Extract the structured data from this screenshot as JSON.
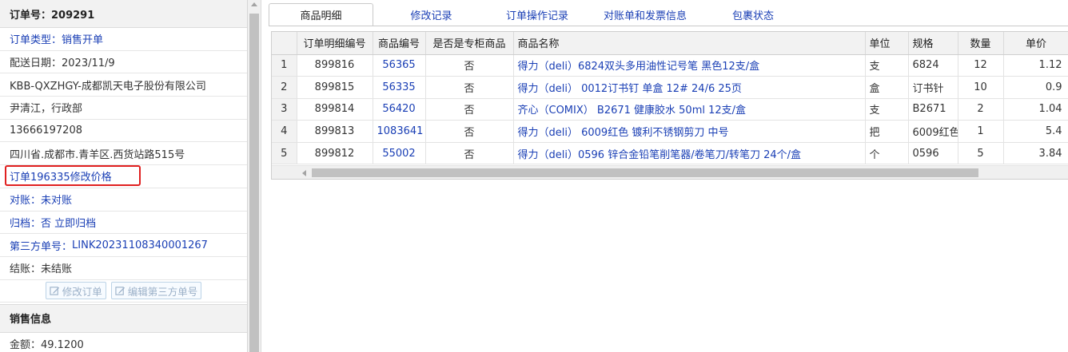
{
  "order": {
    "header": "订单号：209291",
    "type_label": "订单类型：",
    "type_value": "销售开单",
    "delivery_date": "配送日期：2023/11/9",
    "company": "KBB-QXZHGY-成都凯天电子股份有限公司",
    "contact": "尹清江，行政部",
    "phone": "13666197208",
    "address": "四川省.成都市.青羊区.西货站路515号",
    "price_change_note": "订单196335修改价格",
    "reconcile_label": "对账：",
    "reconcile_value": "未对账",
    "archive_label": "归档：",
    "archive_value": "否 立即归档",
    "third_party_label": "第三方单号：",
    "third_party_value": "LINK20231108340001267",
    "settle_label": "结账：",
    "settle_value": "未结账",
    "edit_order_label": "修改订单",
    "edit_third_party_label": "编辑第三方单号"
  },
  "sales": {
    "header": "销售信息",
    "amount": "金额：49.1200"
  },
  "tabs": [
    {
      "label": "商品明细",
      "active": true
    },
    {
      "label": "修改记录"
    },
    {
      "label": "订单操作记录"
    },
    {
      "label": "对账单和发票信息"
    },
    {
      "label": "包裹状态"
    }
  ],
  "table": {
    "headers": [
      "",
      "订单明细编号",
      "商品编号",
      "是否是专柜商品",
      "商品名称",
      "单位",
      "规格",
      "数量",
      "单价"
    ],
    "rows": [
      [
        "1",
        "899816",
        "56365",
        "否",
        "得力（deli）6824双头多用油性记号笔 黑色12支/盒",
        "支",
        "6824",
        "12",
        "1.12"
      ],
      [
        "2",
        "899815",
        "56335",
        "否",
        "得力（deli） 0012订书钉 单盒 12# 24/6 25页",
        "盒",
        "订书针",
        "10",
        "0.9"
      ],
      [
        "3",
        "899814",
        "56420",
        "否",
        "齐心（COMIX） B2671 健康胶水 50ml 12支/盒",
        "支",
        "B2671",
        "2",
        "1.04"
      ],
      [
        "4",
        "899813",
        "1083641",
        "否",
        "得力（deli） 6009红色 镀利不锈钢剪刀 中号",
        "把",
        "6009红色",
        "1",
        "5.4"
      ],
      [
        "5",
        "899812",
        "55002",
        "否",
        "得力（deli）0596 锌合金铅笔削笔器/卷笔刀/转笔刀 24个/盒",
        "个",
        "0596",
        "5",
        "3.84"
      ]
    ]
  },
  "colors": {
    "link_blue": "#1a3fb5",
    "highlight_red": "#e02020",
    "header_gray": "#f2f2f2"
  }
}
